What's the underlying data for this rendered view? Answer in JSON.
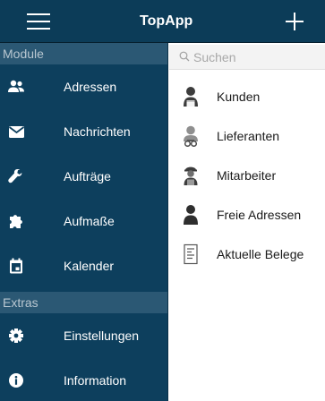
{
  "header": {
    "title": "TopApp",
    "menu_icon": "hamburger-menu-icon",
    "add_icon": "plus-icon"
  },
  "sidebar": {
    "sections": [
      {
        "title": "Module",
        "items": [
          {
            "label": "Adressen",
            "icon": "people-icon"
          },
          {
            "label": "Nachrichten",
            "icon": "envelope-icon"
          },
          {
            "label": "Aufträge",
            "icon": "wrench-icon"
          },
          {
            "label": "Aufmaße",
            "icon": "puzzle-icon"
          },
          {
            "label": "Kalender",
            "icon": "calendar-icon"
          }
        ]
      },
      {
        "title": "Extras",
        "items": [
          {
            "label": "Einstellungen",
            "icon": "gear-icon"
          },
          {
            "label": "Information",
            "icon": "info-icon"
          }
        ]
      }
    ]
  },
  "search": {
    "placeholder": "Suchen",
    "value": ""
  },
  "list": {
    "items": [
      {
        "label": "Kunden",
        "icon": "customer-person-icon"
      },
      {
        "label": "Lieferanten",
        "icon": "supplier-person-icon"
      },
      {
        "label": "Mitarbeiter",
        "icon": "worker-person-icon"
      },
      {
        "label": "Freie Adressen",
        "icon": "person-icon"
      },
      {
        "label": "Aktuelle Belege",
        "icon": "document-icon"
      }
    ]
  },
  "colors": {
    "topbar": "#0c3c58",
    "sidebar": "#0d3f5d",
    "section_header": "#2b5874",
    "text_light": "#ffffff"
  }
}
